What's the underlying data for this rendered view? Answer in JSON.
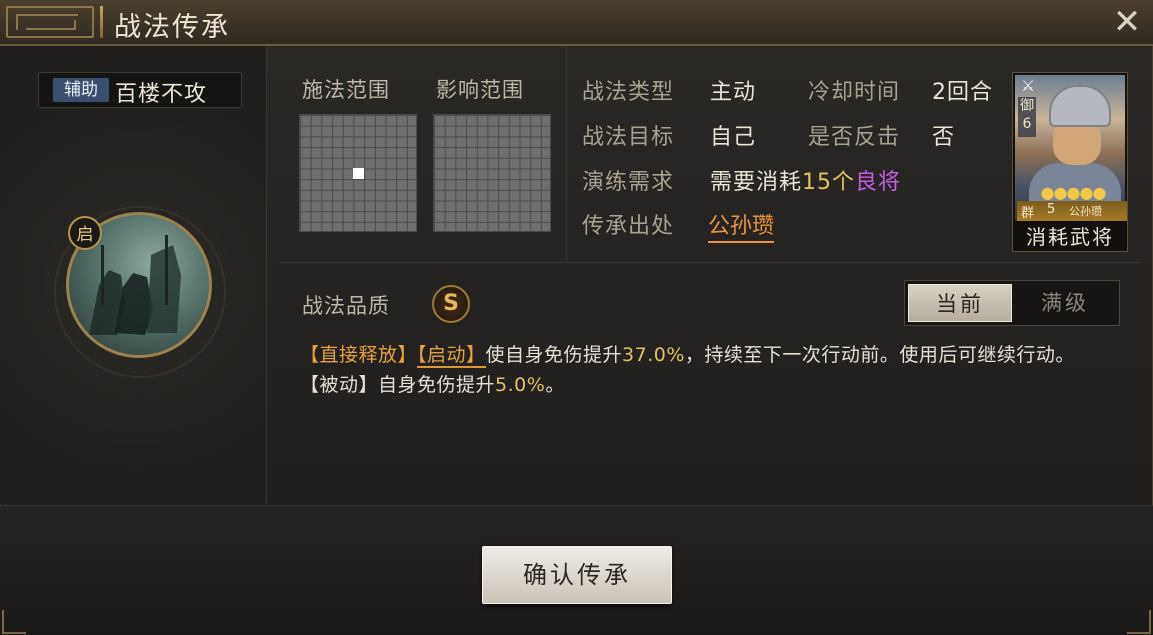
{
  "window": {
    "title": "战法传承",
    "close_icon": "close-icon"
  },
  "skill": {
    "type_tag": "辅助",
    "name": "百楼不攻",
    "emblem_badge": "启"
  },
  "ranges": {
    "cast_label": "施法范围",
    "effect_label": "影响范围"
  },
  "info": {
    "type_label": "战法类型",
    "type_value": "主动",
    "cooldown_label": "冷却时间",
    "cooldown_value": "2回合",
    "target_label": "战法目标",
    "target_value": "自己",
    "counter_label": "是否反击",
    "counter_value": "否",
    "drill_label": "演练需求",
    "drill_prefix": "需要消耗",
    "drill_count": "15个",
    "drill_quality": "良将",
    "source_label": "传承出处",
    "source_value": "公孙瓒"
  },
  "card": {
    "troop_icon": "cavalry-icon",
    "side_text": "御",
    "side_num": "6",
    "stars": "CCCCC",
    "faction": "群",
    "cost": "5",
    "general_name": "公孙瓒",
    "consume_label": "消耗武将"
  },
  "quality": {
    "label": "战法品质",
    "grade": "S"
  },
  "toggle": {
    "current": "当前",
    "max": "满级"
  },
  "description": {
    "tag1": "【直接释放】",
    "tag2": "【启动】",
    "text1": "使自身免伤提升",
    "value1": "37.0%",
    "text2": "，持续至下一次行动前。使用后可继续行动。",
    "passive_tag": "【被动】",
    "passive_text": "自身免伤提升",
    "passive_value": "5.0%",
    "passive_end": "。"
  },
  "footer": {
    "confirm": "确认传承"
  },
  "colors": {
    "accent_gold": "#e2c25a",
    "quality_purple": "#c35ee0",
    "source_orange": "#e8953a"
  }
}
